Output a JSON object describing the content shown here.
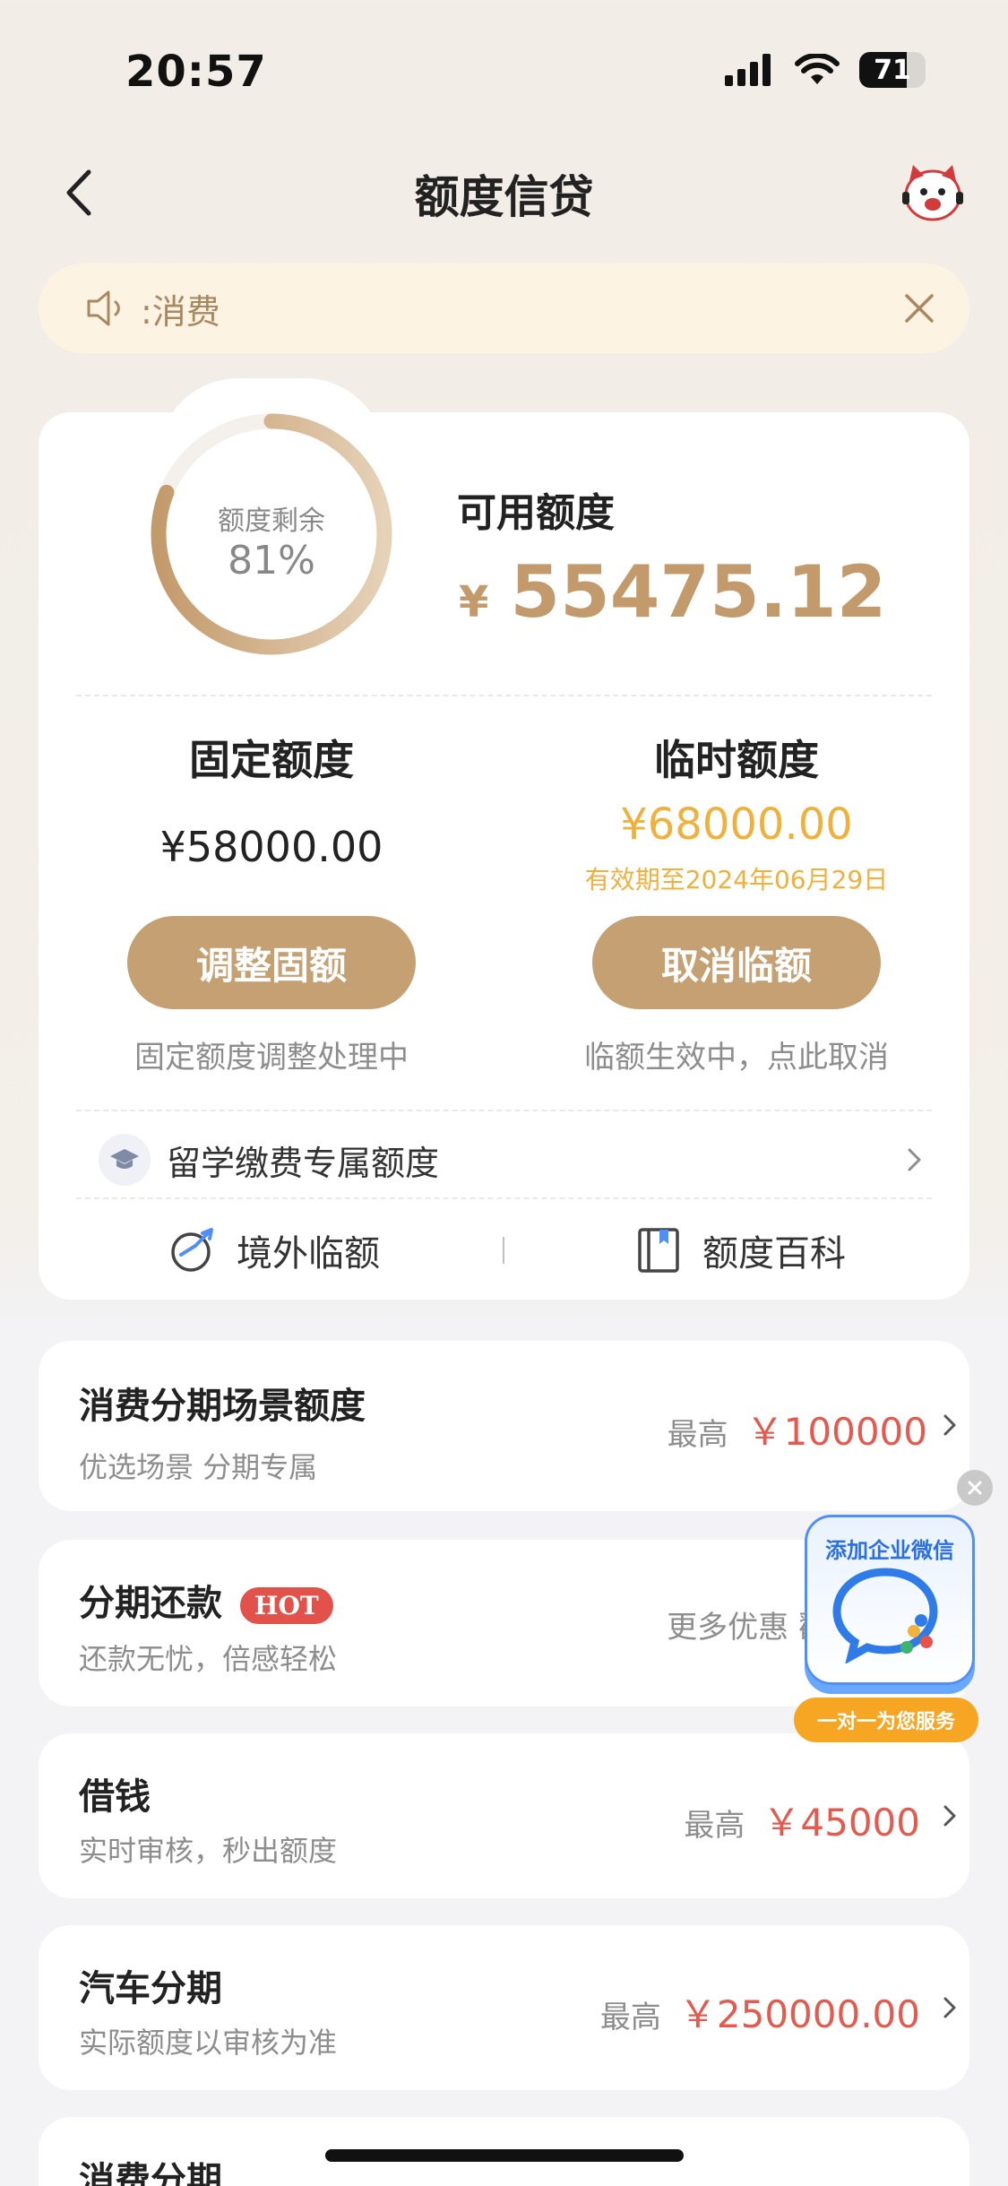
{
  "status_bar": {
    "time": "20:57",
    "battery": "71"
  },
  "nav": {
    "title": "额度信贷"
  },
  "notice": {
    "text": ":消费"
  },
  "summary": {
    "ring_label": "额度剩余",
    "ring_percent": "81%",
    "ring_fraction": 0.81,
    "available_label": "可用额度",
    "currency": "¥",
    "available_amount": "55475.12"
  },
  "fixed": {
    "title": "固定额度",
    "amount": "¥58000.00",
    "button": "调整固额",
    "hint": "固定额度调整处理中"
  },
  "temporary": {
    "title": "临时额度",
    "amount": "¥68000.00",
    "expiry": "有效期至2024年06月29日",
    "button": "取消临额",
    "hint": "临额生效中，点此取消"
  },
  "study": {
    "label": "留学缴费专属额度"
  },
  "links": {
    "overseas": "境外临额",
    "wiki": "额度百科"
  },
  "cards": [
    {
      "title": "消费分期场景额度",
      "subtitle": "优选场景 分期专属",
      "prefix": "最高",
      "value": "￥100000"
    },
    {
      "title": "分期还款",
      "badge": "HOT",
      "subtitle": "还款无忧，倍感轻松",
      "prefix": "更多优惠 戳"
    },
    {
      "title": "借钱",
      "subtitle": "实时审核，秒出额度",
      "prefix": "最高",
      "value": "￥45000"
    },
    {
      "title": "汽车分期",
      "subtitle": "实际额度以审核为准",
      "prefix": "最高",
      "value": "￥250000.00"
    },
    {
      "title": "消费分期"
    }
  ],
  "floating": {
    "title": "添加企业微信",
    "banner": "一对一为您服务"
  },
  "colors": {
    "gold": "#c5a073",
    "amount_orange": "#f0b03c",
    "red": "#e55a4f",
    "widget_blue": "#2b6fe6"
  }
}
